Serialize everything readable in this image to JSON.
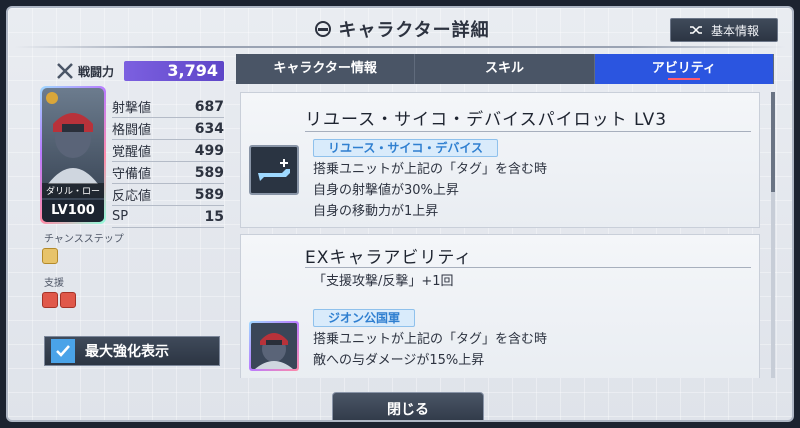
{
  "header": {
    "title": "キャラクター詳細",
    "basic_info_label": "基本情報"
  },
  "left": {
    "power_label": "戦闘力",
    "power_value": "3,794",
    "portrait_name": "ダリル・ロー",
    "portrait_level": "LV100",
    "stats": [
      {
        "label": "射撃値",
        "value": "687"
      },
      {
        "label": "格闘値",
        "value": "634"
      },
      {
        "label": "覚醒値",
        "value": "499"
      },
      {
        "label": "守備値",
        "value": "589"
      },
      {
        "label": "反応値",
        "value": "589"
      },
      {
        "label": "SP",
        "value": "15"
      }
    ],
    "chance_step_label": "チャンスステップ",
    "support_label": "支援",
    "max_enhance_label": "最大強化表示"
  },
  "tabs": [
    {
      "label": "キャラクター情報",
      "active": false
    },
    {
      "label": "スキル",
      "active": false
    },
    {
      "label": "アビリティ",
      "active": true
    }
  ],
  "abilities": [
    {
      "title": "リユース・サイコ・デバイスパイロット LV3",
      "tag": "リユース・サイコ・デバイス",
      "lines": [
        "搭乗ユニットが上記の「タグ」を含む時",
        "自身の射撃値が30%上昇",
        "自身の移動力が1上昇"
      ],
      "icon": "weapon-icon"
    },
    {
      "title": "EXキャラアビリティ",
      "note": "「支援攻撃/反撃」+1回",
      "tag": "ジオン公国軍",
      "lines": [
        "搭乗ユニットが上記の「タグ」を含む時",
        "敵への与ダメージが15%上昇"
      ],
      "icon": "character-icon"
    }
  ],
  "footer": {
    "close_label": "閉じる"
  },
  "colors": {
    "accent_blue": "#2b55e0",
    "power_purple": "#6a50d6",
    "tag_blue": "#2f7fd0"
  }
}
